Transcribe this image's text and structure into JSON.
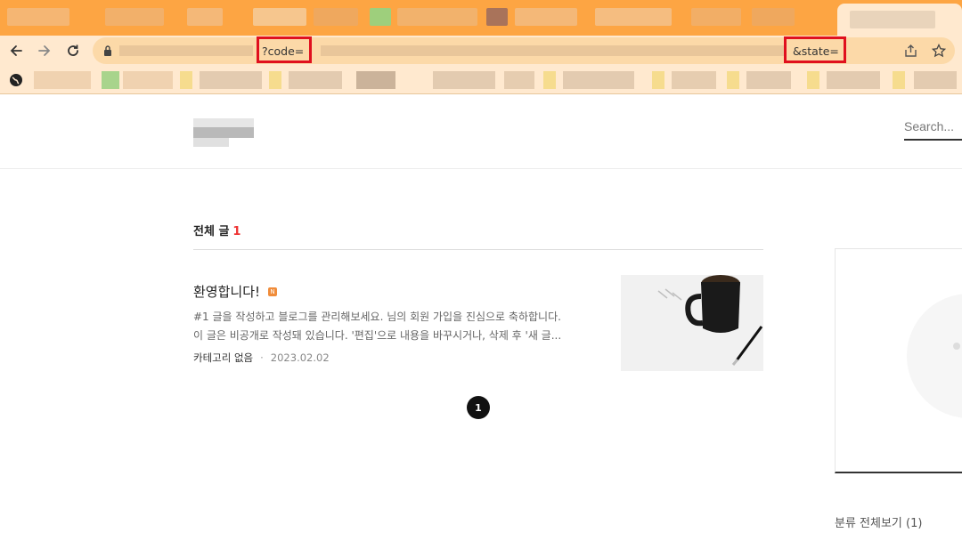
{
  "browser": {
    "url_code_param": "?code=",
    "url_state_param": "&state=",
    "colors": {
      "tabbar": "#fda543",
      "toolbar": "#ffe9cf",
      "highlight_border": "#e0101e"
    }
  },
  "header": {
    "search_placeholder": "Search..."
  },
  "main": {
    "section_title": "전체 글",
    "section_count": "1",
    "post": {
      "title": "환영합니다!",
      "new_badge": "N",
      "excerpt_line1": "#1 글을 작성하고 블로그를 관리해보세요. 님의 회원 가입을 진심으로 축하합니다.",
      "excerpt_line2": "이 글은 비공개로 작성돼 있습니다. '편집'으로 내용을 바꾸시거나, 삭제 후 '새 글...",
      "category": "카테고리 없음",
      "separator": "·",
      "date": "2023.02.02"
    },
    "pagination": {
      "current": "1"
    }
  },
  "sidebar": {
    "category_link": "분류 전체보기 (1)"
  }
}
